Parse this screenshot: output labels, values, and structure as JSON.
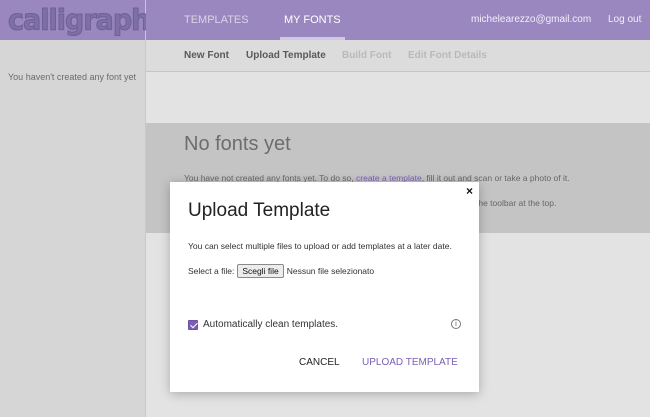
{
  "app": {
    "logo_text": "calligraphr"
  },
  "sidebar": {
    "empty_message": "You haven't created any font yet"
  },
  "topnav": {
    "tabs": [
      {
        "label": "TEMPLATES"
      },
      {
        "label": "MY FONTS"
      }
    ],
    "active_tab": "MY FONTS",
    "user_email": "michelearezzo@gmail.com",
    "logout_label": "Log out"
  },
  "subnav": {
    "items": [
      {
        "label": "New Font",
        "enabled": true
      },
      {
        "label": "Upload Template",
        "enabled": true
      },
      {
        "label": "Build Font",
        "enabled": false
      },
      {
        "label": "Edit Font Details",
        "enabled": false
      }
    ]
  },
  "main": {
    "title": "No fonts yet",
    "text_before_link": "You have not created any fonts yet. To do so, ",
    "link_text": "create a template",
    "text_after_link": ", fill it out and scan or take a photo of it.",
    "text_line2": "the toolbar at the top."
  },
  "modal": {
    "close_glyph": "×",
    "title": "Upload Template",
    "description": "You can select multiple files to upload or add templates at a later date.",
    "file_label": "Select a file:",
    "file_button_label": "Scegli file",
    "file_status": "Nessun file selezionato",
    "checkbox_label": "Automatically clean templates.",
    "checkbox_checked": true,
    "info_glyph": "i",
    "cancel_label": "CANCEL",
    "upload_label": "UPLOAD TEMPLATE"
  },
  "colors": {
    "accent": "#7a5fb5",
    "header": "#9b87bf"
  }
}
